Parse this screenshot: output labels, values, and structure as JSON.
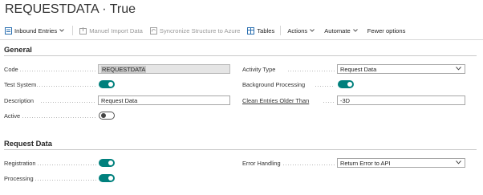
{
  "page": {
    "title": "REQUESTDATA · True"
  },
  "toolbar": {
    "inbound_entries": "Inbound Entries",
    "manuel_import_data": "Manuel Import Data",
    "syncronize_structure": "Syncronize Structure to Azure",
    "tables": "Tables",
    "actions": "Actions",
    "automate": "Automate",
    "fewer_options": "Fewer options"
  },
  "general": {
    "title": "General",
    "code_label": "Code",
    "code_value": "REQUESTDATA",
    "test_system_label": "Test System",
    "test_system_on": true,
    "description_label": "Description",
    "description_value": "Request Data",
    "active_label": "Active",
    "active_on": false,
    "activity_type_label": "Activity Type",
    "activity_type_value": "Request Data",
    "background_processing_label": "Background Processing",
    "background_processing_on": true,
    "clean_entries_label": "Clean Entries Older Than",
    "clean_entries_value": "-3D"
  },
  "request_data": {
    "title": "Request Data",
    "registration_label": "Registration",
    "registration_on": true,
    "processing_label": "Processing",
    "processing_on": true,
    "error_handling_label": "Error Handling",
    "error_handling_value": "Return Error to API"
  },
  "colors": {
    "accent": "#00807d",
    "field_border": "#a7a7a7",
    "highlight_bg": "#e5e5e5"
  }
}
